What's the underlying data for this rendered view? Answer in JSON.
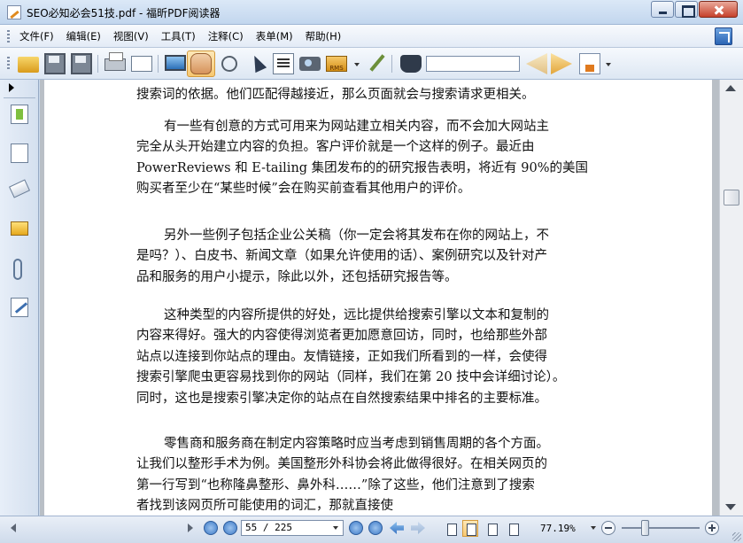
{
  "window": {
    "title": "SEO必知必会51技.pdf - 福昕PDF阅读器"
  },
  "menu": {
    "items": [
      "文件(F)",
      "编辑(E)",
      "视图(V)",
      "工具(T)",
      "注释(C)",
      "表单(M)",
      "帮助(H)"
    ]
  },
  "toolbar": {
    "icons": [
      "open-folder-icon",
      "save-icon",
      "save-as-icon",
      "print-icon",
      "properties-icon",
      "fullscreen-icon",
      "hand-tool-icon",
      "zoom-tool-icon",
      "select-tool-icon",
      "text-select-icon",
      "snapshot-icon",
      "rms-icon",
      "typewriter-icon",
      "find-icon"
    ],
    "rms_label": "RMS",
    "search_value": "",
    "active_tool": "hand"
  },
  "document": {
    "paragraphs": [
      {
        "lines": [
          "搜索词的依据。他们匹配得越接近，那么页面就会与搜索请求更相关。"
        ]
      },
      {
        "lines": [
          "有一些有创意的方式可用来为网站建立相关内容，而不会加大网站主",
          "完全从头开始建立内容的负担。客户评价就是一个这样的例子。最近由",
          "PowerReviews 和 E-tailing 集团发布的的研究报告表明，将近有 90%的美国",
          "购买者至少在“某些时候”会在购买前查看其他用户的评价。"
        ]
      },
      {
        "lines": [
          "另外一些例子包括企业公关稿（你一定会将其发布在你的网站上，不",
          "是吗？）、白皮书、新闻文章（如果允许使用的话）、案例研究以及针对产",
          "品和服务的用户小提示，除此以外，还包括研究报告等。"
        ]
      },
      {
        "lines": [
          "这种类型的内容所提供的好处，远比提供给搜索引擎以文本和复制的",
          "内容来得好。强大的内容使得浏览者更加愿意回访，同时，也给那些外部",
          "站点以连接到你站点的理由。友情链接，正如我们所看到的一样，会使得",
          "搜索引擎爬虫更容易找到你的网站（同样，我们在第 20 技中会详细讨论）。",
          "同时，这也是搜索引擎决定你的站点在自然搜索结果中排名的主要标准。"
        ]
      },
      {
        "lines": [
          "零售商和服务商在制定内容策略时应当考虑到销售周期的各个方面。",
          "让我们以整形手术为例。美国整形外科协会将此做得很好。在相关网页的",
          "第一行写到“也称隆鼻整形、鼻外科……”除了这些，他们注意到了搜索",
          "者找到该网页所可能使用的词汇，那就直接使"
        ]
      }
    ]
  },
  "statusbar": {
    "page_indicator": "55 / 225",
    "zoom": "77.19%",
    "zoom_level": 0.3
  }
}
